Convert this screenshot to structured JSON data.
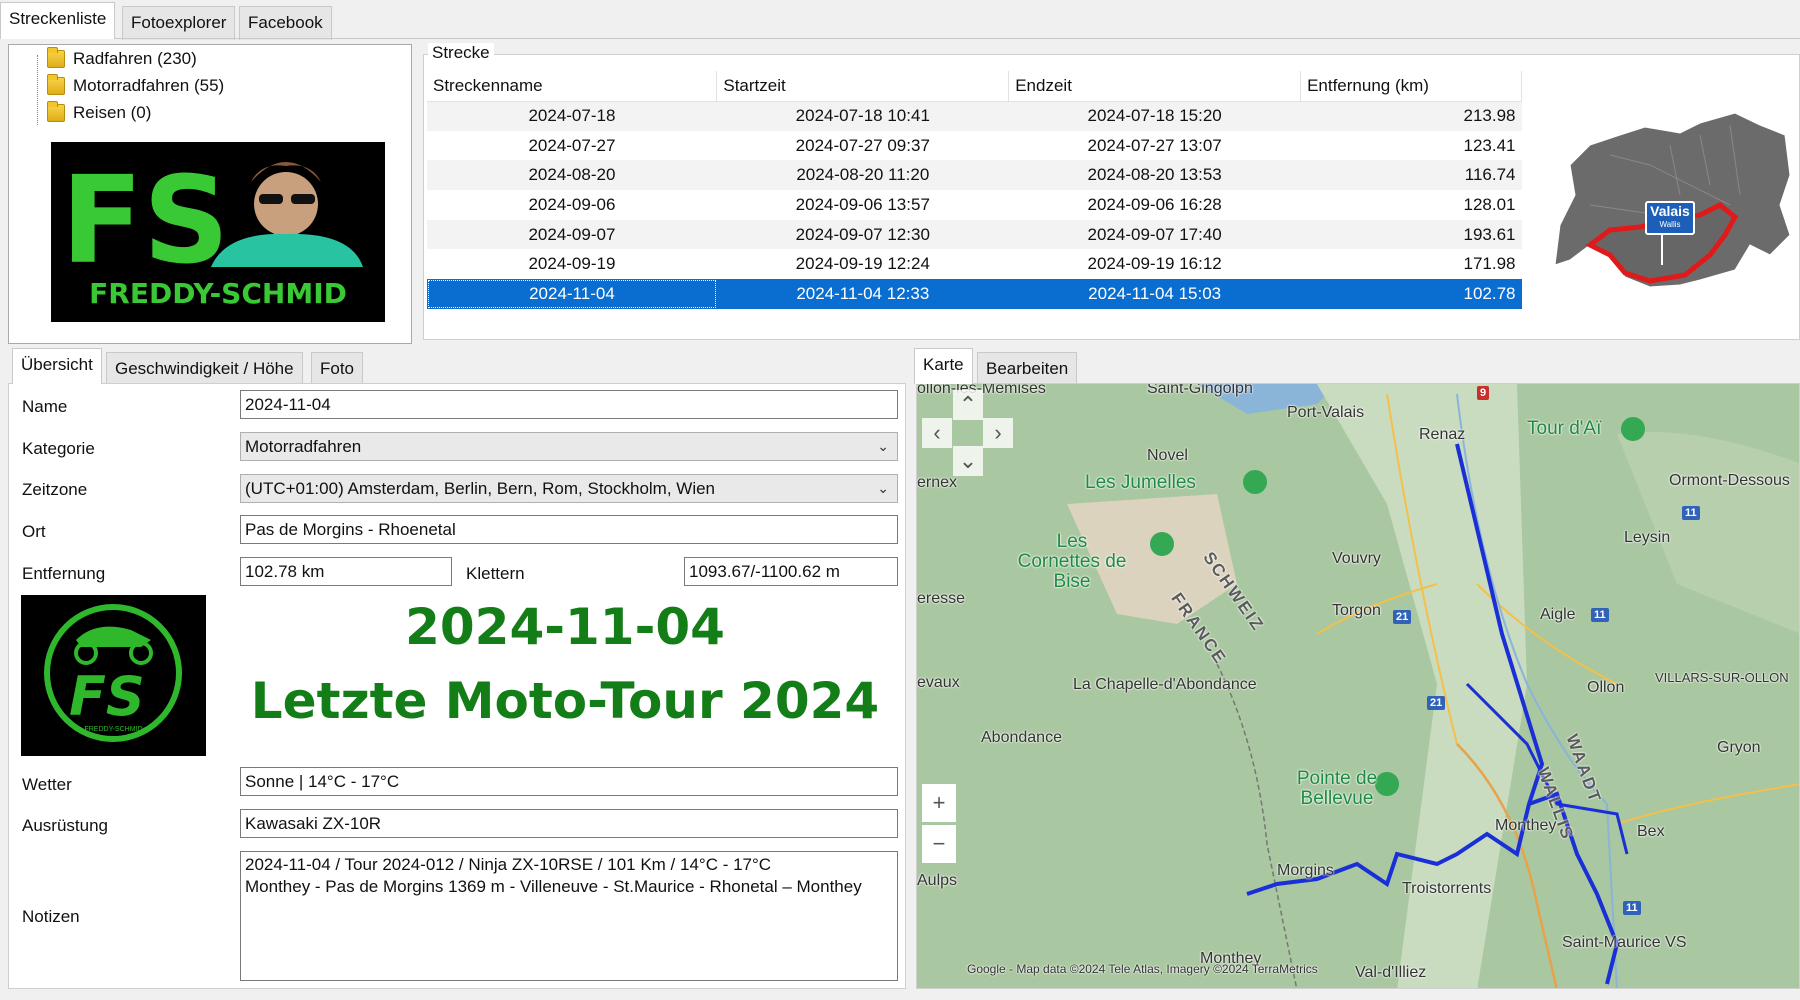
{
  "top_tabs": [
    "Streckenliste",
    "Fotoexplorer",
    "Facebook"
  ],
  "tree": {
    "items": [
      "Radfahren (230)",
      "Motorradfahren (55)",
      "Reisen (0)"
    ]
  },
  "logo_fs": {
    "letters": "FS",
    "text": "FREDDY-SCHMID"
  },
  "strecke": {
    "group_label": "Strecke",
    "columns": [
      "Streckenname",
      "Startzeit",
      "Endzeit",
      "Entfernung (km)"
    ],
    "rows": [
      [
        "2024-07-18",
        "2024-07-18 10:41",
        "2024-07-18 15:20",
        "213.98"
      ],
      [
        "2024-07-27",
        "2024-07-27 09:37",
        "2024-07-27 13:07",
        "123.41"
      ],
      [
        "2024-08-20",
        "2024-08-20 11:20",
        "2024-08-20 13:53",
        "116.74"
      ],
      [
        "2024-09-06",
        "2024-09-06 13:57",
        "2024-09-06 16:28",
        "128.01"
      ],
      [
        "2024-09-07",
        "2024-09-07 12:30",
        "2024-09-07 17:40",
        "193.61"
      ],
      [
        "2024-09-19",
        "2024-09-19 12:24",
        "2024-09-19 16:12",
        "171.98"
      ],
      [
        "2024-11-04",
        "2024-11-04 12:33",
        "2024-11-04 15:03",
        "102.78"
      ]
    ],
    "selected_row": 6
  },
  "canton": {
    "name": "Valais",
    "sub": "Wallis"
  },
  "detail_tabs": [
    "Übersicht",
    "Geschwindigkeit / Höhe",
    "Foto"
  ],
  "form": {
    "name_label": "Name",
    "name_value": "2024-11-04",
    "kategorie_label": "Kategorie",
    "kategorie_value": "Motorradfahren",
    "zeitzone_label": "Zeitzone",
    "zeitzone_value": "(UTC+01:00) Amsterdam, Berlin, Bern, Rom, Stockholm, Wien",
    "ort_label": "Ort",
    "ort_value": "Pas de Morgins - Rhoenetal",
    "entfernung_label": "Entfernung",
    "entfernung_value": "102.78 km",
    "klettern_label": "Klettern",
    "klettern_value": "1093.67/-1100.62 m",
    "wetter_label": "Wetter",
    "wetter_value": "Sonne | 14°C - 17°C",
    "ausruestung_label": "Ausrüstung",
    "ausruestung_value": "Kawasaki ZX-10R",
    "notizen_label": "Notizen",
    "notizen_line1": "2024-11-04 / Tour 2024-012 / Ninja ZX-10RSE / 101 Km / 14°C - 17°C",
    "notizen_line2": "Monthey - Pas de Morgins 1369 m - Villeneuve - St.Maurice - Rhonetal – Monthey"
  },
  "logo_small": {
    "letters": "FS",
    "text": "FREDDY-SCHMID"
  },
  "headline": {
    "line1": "2024-11-04",
    "line2": "Letzte Moto-Tour 2024"
  },
  "map_tabs": [
    "Karte",
    "Bearbeiten"
  ],
  "map": {
    "labels": [
      "Saint-Gingolph",
      "Port-Valais",
      "Novel",
      "Les Jumelles",
      "Les Cornettes de Bise",
      "Vouvry",
      "Torgon",
      "Aigle",
      "Ollon",
      "Tour d'Aï",
      "Ormont-Dessous",
      "Leysin",
      "La Chapelle-d'Abondance",
      "Abondance",
      "Pointe de Bellevue",
      "Morgins",
      "Troistorrents",
      "Monthey",
      "Bex",
      "Saint-Maurice VS",
      "Val-d'Illiez",
      "Gryon",
      "VILLARS-SUR-OLLON",
      "SCHWEIZ",
      "FRANCE",
      "WAADT",
      "WALLIS",
      "Renaz",
      "Aulps",
      "ollon-les-Memises",
      "ernex",
      "eresse",
      "evaux"
    ],
    "shields": [
      "9",
      "21",
      "21",
      "11",
      "11",
      "11"
    ],
    "attribution": "Google - Map data ©2024 Tele Atlas, Imagery ©2024 TerraMetrics",
    "zoom_in": "+",
    "zoom_out": "−"
  },
  "colors": {
    "accent": "#0a6ed1",
    "route": "#1b2fd6",
    "headline": "#137d17",
    "map_bg": "#a8c9a0"
  }
}
